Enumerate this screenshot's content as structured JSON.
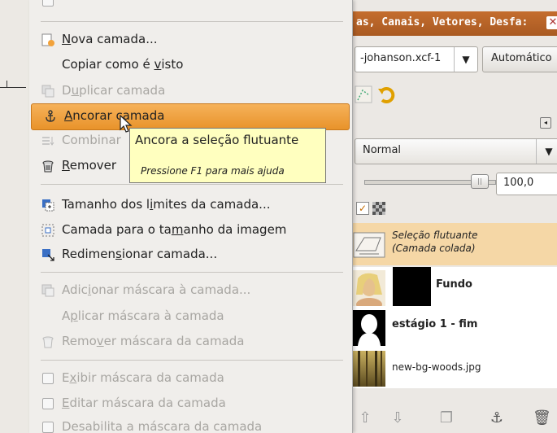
{
  "dock": {
    "title": "as, Canais, Vetores, Desfa:",
    "image_combo": "-johanson.xcf-1",
    "auto_button": "Automático",
    "mode": "Normal",
    "opacity": "100,0",
    "layers": [
      {
        "name_line1": "Seleção flutuante",
        "name_line2": "(Camada colada)"
      },
      {
        "name": "Fundo"
      },
      {
        "name": "estágio 1 - fim"
      },
      {
        "name": "new-bg-woods.jpg"
      }
    ]
  },
  "menu": {
    "items": [
      {
        "pre": "",
        "u": "N",
        "post": "ova camada...",
        "disabled": false
      },
      {
        "pre": "Copiar como é ",
        "u": "v",
        "post": "isto",
        "disabled": false
      },
      {
        "pre": "D",
        "u": "u",
        "post": "plicar camada",
        "disabled": true
      },
      {
        "pre": "",
        "u": "A",
        "post": "ncorar camada",
        "disabled": false,
        "selected": true
      },
      {
        "pre": "Combinar",
        "u": "",
        "post": "",
        "disabled": true
      },
      {
        "pre": "",
        "u": "R",
        "post": "emover",
        "disabled": false
      },
      {
        "pre": "Tamanho dos l",
        "u": "i",
        "post": "mites da camada...",
        "disabled": false
      },
      {
        "pre": "Camada para o ta",
        "u": "m",
        "post": "anho da imagem",
        "disabled": false
      },
      {
        "pre": "Redimen",
        "u": "s",
        "post": "ionar camada...",
        "disabled": false
      },
      {
        "pre": "Adic",
        "u": "i",
        "post": "onar máscara à camada...",
        "disabled": true
      },
      {
        "pre": "A",
        "u": "p",
        "post": "licar máscara à camada",
        "disabled": true
      },
      {
        "pre": "Remo",
        "u": "v",
        "post": "er máscara da camada",
        "disabled": true
      },
      {
        "pre": "E",
        "u": "x",
        "post": "ibir máscara da camada",
        "disabled": true
      },
      {
        "pre": "",
        "u": "E",
        "post": "ditar máscara da camada",
        "disabled": true
      },
      {
        "pre": "Desabilita a máscara da camada",
        "u": "",
        "post": "",
        "disabled": true
      }
    ]
  },
  "tooltip": {
    "text": "Ancora a seleção flutuante",
    "help": "Pressione F1 para mais ajuda"
  }
}
